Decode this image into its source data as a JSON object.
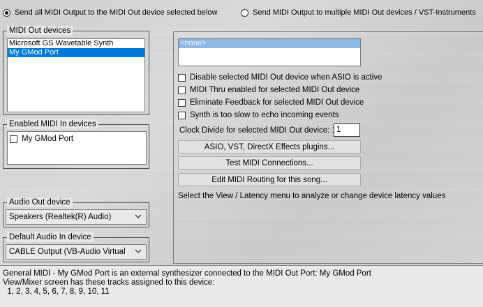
{
  "output_mode": {
    "option_single": "Send all MIDI Output to the MIDI Out device selected below",
    "option_multiple": "Send MIDI Output to multiple MIDI Out devices / VST-Instruments",
    "selected": "single"
  },
  "midi_out": {
    "label": "MIDI Out devices",
    "items": [
      "Microsoft GS Wavetable Synth",
      "My GMod Port"
    ],
    "selected_index": 1
  },
  "midi_in": {
    "label": "Enabled MIDI In devices",
    "items": [
      {
        "label": "My GMod Port",
        "checked": false
      }
    ]
  },
  "audio_out": {
    "label": "Audio Out device",
    "value": "Speakers (Realtek(R) Audio)"
  },
  "audio_in": {
    "label": "Default Audio In device",
    "value": "CABLE Output (VB-Audio Virtual"
  },
  "right_panel": {
    "selected_item": "<none>",
    "options": [
      {
        "label": "Disable selected MIDI Out device when ASIO is active",
        "checked": false
      },
      {
        "label": "MIDI Thru enabled for selected MIDI Out device",
        "checked": false
      },
      {
        "label": "Eliminate Feedback for selected MIDI Out device",
        "checked": false
      },
      {
        "label": "Synth is too slow to echo incoming events",
        "checked": false
      }
    ],
    "clock_divide_label": "Clock Divide for selected MIDI Out device: 1/",
    "clock_divide_value": "1",
    "buttons": {
      "effects": "ASIO, VST, DirectX Effects plugins...",
      "test": "Test MIDI Connections...",
      "routing": "Edit MIDI Routing for this song..."
    },
    "latency_note": "Select the View / Latency menu to analyze or change device latency values"
  },
  "status": {
    "line1": "General MIDI - My GMod Port is an external synthesizer connected to the MIDI Out Port:  My GMod Port",
    "line2": "View/Mixer screen has these tracks assigned to this device:",
    "line3": "  1, 2, 3, 4, 5, 6, 7, 8, 9, 10, 11"
  },
  "colors": {
    "selection": "#0078d7",
    "disabled_selection": "#8fb7e6"
  }
}
